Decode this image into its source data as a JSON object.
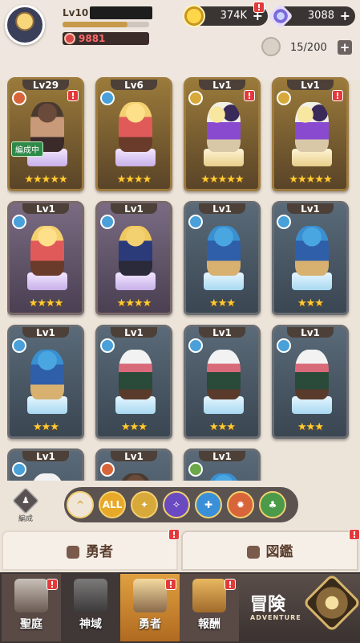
{
  "player": {
    "level": "Lv10",
    "name": "",
    "exp_fraction": 0.75,
    "power": "9881"
  },
  "currency": {
    "gold": "374K",
    "gems": "3088",
    "plus": "+"
  },
  "capacity": {
    "text": "15/200",
    "plus": "+"
  },
  "badge": "!",
  "heroes": [
    {
      "lv": "Lv29",
      "element": "fire",
      "sprite": "cat",
      "stars": "★★★★★",
      "pedestal": "purple",
      "bg": "gold",
      "status": "編成中",
      "badge": true
    },
    {
      "lv": "Lv6",
      "element": "water",
      "sprite": "blonde",
      "stars": "★★★★",
      "pedestal": "purple",
      "bg": "gold",
      "status": "",
      "badge": false
    },
    {
      "lv": "Lv1",
      "element": "light",
      "sprite": "duo",
      "stars": "★★★★★",
      "pedestal": "gold",
      "bg": "gold",
      "status": "",
      "badge": true
    },
    {
      "lv": "Lv1",
      "element": "light",
      "sprite": "duo",
      "stars": "★★★★★",
      "pedestal": "gold",
      "bg": "gold",
      "status": "",
      "badge": true
    },
    {
      "lv": "Lv1",
      "element": "water",
      "sprite": "blonde",
      "stars": "★★★★",
      "pedestal": "purple",
      "bg": "purple",
      "status": "",
      "badge": false
    },
    {
      "lv": "Lv1",
      "element": "water",
      "sprite": "knight",
      "stars": "★★★★",
      "pedestal": "purple",
      "bg": "purple",
      "status": "",
      "badge": false
    },
    {
      "lv": "Lv1",
      "element": "water",
      "sprite": "archer",
      "stars": "★★★",
      "pedestal": "blue",
      "bg": "blue",
      "status": "",
      "badge": false
    },
    {
      "lv": "Lv1",
      "element": "water",
      "sprite": "archer",
      "stars": "★★★",
      "pedestal": "blue",
      "bg": "blue",
      "status": "",
      "badge": false
    },
    {
      "lv": "Lv1",
      "element": "water",
      "sprite": "archer",
      "stars": "★★★",
      "pedestal": "blue",
      "bg": "blue",
      "status": "",
      "badge": false
    },
    {
      "lv": "Lv1",
      "element": "water",
      "sprite": "witch",
      "stars": "★★★",
      "pedestal": "blue",
      "bg": "blue",
      "status": "",
      "badge": false
    },
    {
      "lv": "Lv1",
      "element": "water",
      "sprite": "witch",
      "stars": "★★★",
      "pedestal": "blue",
      "bg": "blue",
      "status": "",
      "badge": false
    },
    {
      "lv": "Lv1",
      "element": "water",
      "sprite": "witch",
      "stars": "★★★",
      "pedestal": "blue",
      "bg": "blue",
      "status": "",
      "badge": false
    },
    {
      "lv": "Lv1",
      "element": "water",
      "sprite": "witch",
      "stars": "",
      "pedestal": "blue",
      "bg": "blue",
      "status": "",
      "badge": false
    },
    {
      "lv": "Lv1",
      "element": "fire",
      "sprite": "cat",
      "stars": "",
      "pedestal": "blue",
      "bg": "blue",
      "status": "",
      "badge": false
    },
    {
      "lv": "Lv1",
      "element": "earth",
      "sprite": "archer",
      "stars": "",
      "pedestal": "blue",
      "bg": "blue",
      "status": "",
      "badge": false
    }
  ],
  "filters": {
    "formation_label": "編成",
    "all_label": "ALL",
    "items": [
      "arrow",
      "all",
      "light",
      "dark",
      "water",
      "fire",
      "earth"
    ]
  },
  "tabs": {
    "hero": "勇者",
    "book": "図鑑"
  },
  "nav": {
    "sanctuary": "聖庭",
    "divine": "神域",
    "hero": "勇者",
    "reward": "報酬",
    "adventure": "冒険",
    "adventure_sub": "ADVENTURE"
  },
  "colors": {
    "accent_gold": "#e7a927",
    "badge_red": "#e23a3a",
    "power_red": "#ff6b6b"
  }
}
